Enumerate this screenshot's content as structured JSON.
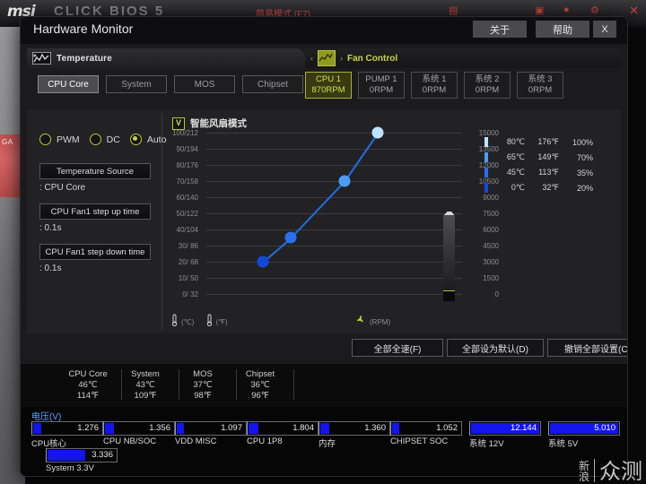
{
  "background": {
    "brand": "msi",
    "brand_sub": "CLICK BIOS 5",
    "mode_label": "简易模式 (F7)",
    "badge": "GA",
    "close": "✕"
  },
  "window": {
    "title": "Hardware Monitor",
    "about_label": "关于",
    "help_label": "帮助",
    "close_label": "X"
  },
  "sections": {
    "temperature": {
      "label": "Temperature",
      "icon": "temperature-graph-icon"
    },
    "fan_control": {
      "label": "Fan Control",
      "icon": "fan-graph-icon",
      "prev": "‹",
      "next": "›"
    }
  },
  "source_tabs": [
    {
      "label": "CPU Core",
      "selected": true
    },
    {
      "label": "System",
      "selected": false
    },
    {
      "label": "MOS",
      "selected": false
    },
    {
      "label": "Chipset",
      "selected": false
    }
  ],
  "fan_tabs": [
    {
      "label": "CPU 1",
      "value": "870RPM",
      "selected": true
    },
    {
      "label": "PUMP 1",
      "value": "0RPM",
      "selected": false
    },
    {
      "label": "系统 1",
      "value": "0RPM",
      "selected": false
    },
    {
      "label": "系统 2",
      "value": "0RPM",
      "selected": false
    },
    {
      "label": "系统 3",
      "value": "0RPM",
      "selected": false
    }
  ],
  "controls": {
    "modes": [
      {
        "label": "PWM",
        "selected": false
      },
      {
        "label": "DC",
        "selected": false
      },
      {
        "label": "Auto",
        "selected": true
      }
    ],
    "temp_source_btn": "Temperature Source",
    "temp_source_val": ": CPU Core",
    "step_up_btn": "CPU Fan1 step up time",
    "step_up_val": ": 0.1s",
    "step_down_btn": "CPU Fan1 step down time",
    "step_down_val": ": 0.1s"
  },
  "chart_panel": {
    "smart_mode_label": "智能风扇模式",
    "smart_mode_checked": "V",
    "unit_c": "(℃)",
    "unit_f": "(℉)",
    "unit_rpm": "(RPM)"
  },
  "chart_data": {
    "type": "line",
    "title": "智能风扇模式",
    "xlabel": "",
    "ylabel": "℃ / ℉",
    "y_left_ticks": [
      "100/212",
      "90/194",
      "80/176",
      "70/158",
      "60/140",
      "50/122",
      "40/104",
      "30/ 86",
      "20/ 68",
      "10/ 50",
      "0/ 32"
    ],
    "y_right_ticks": [
      "15000",
      "13500",
      "12000",
      "10500",
      "9000",
      "7500",
      "6000",
      "4500",
      "3000",
      "1500",
      "0"
    ],
    "y_left_range": [
      0,
      100
    ],
    "y_right_range": [
      0,
      15000
    ],
    "grid": true,
    "points": [
      {
        "temp_c": 22,
        "duty_pct": 20,
        "color": "#1448d8"
      },
      {
        "temp_c": 33,
        "duty_pct": 35,
        "color": "#2b6ef0"
      },
      {
        "temp_c": 54,
        "duty_pct": 70,
        "color": "#4d9bf5"
      },
      {
        "temp_c": 67,
        "duty_pct": 100,
        "color": "#bfe3fb"
      }
    ],
    "line_color": "#1f6ee8",
    "rpm_indicator": 870,
    "legend": [
      {
        "swatch": "#bfe3fb",
        "c": "80℃",
        "f": "176℉",
        "pct": "100%"
      },
      {
        "swatch": "#4d9bf5",
        "c": "65℃",
        "f": "149℉",
        "pct": "70%"
      },
      {
        "swatch": "#2b6ef0",
        "c": "45℃",
        "f": "113℉",
        "pct": "35%"
      },
      {
        "swatch": "#1448d8",
        "c": "0℃",
        "f": "32℉",
        "pct": "20%"
      }
    ]
  },
  "actions": [
    {
      "label": "全部全速(F)"
    },
    {
      "label": "全部设为默认(D)"
    },
    {
      "label": "撤销全部设置(C)"
    }
  ],
  "temp_summary": [
    {
      "name": "CPU Core",
      "c": "46℃",
      "f": "114℉"
    },
    {
      "name": "System",
      "c": "43℃",
      "f": "109℉"
    },
    {
      "name": "MOS",
      "c": "37℃",
      "f": "98℉"
    },
    {
      "name": "Chipset",
      "c": "36℃",
      "f": "96℉"
    }
  ],
  "voltage": {
    "title": "电压(V)",
    "items": [
      {
        "label": "CPU核心",
        "value": "1.276",
        "fill_pct": 12
      },
      {
        "label": "CPU NB/SOC",
        "value": "1.356",
        "fill_pct": 13
      },
      {
        "label": "VDD MISC",
        "value": "1.097",
        "fill_pct": 11
      },
      {
        "label": "CPU 1P8",
        "value": "1.804",
        "fill_pct": 15
      },
      {
        "label": "内存",
        "value": "1.360",
        "fill_pct": 13
      },
      {
        "label": "CHIPSET SOC",
        "value": "1.052",
        "fill_pct": 10
      },
      {
        "label": "系统 12V",
        "value": "12.144",
        "fill_pct": 100
      },
      {
        "label": "系统 5V",
        "value": "5.010",
        "fill_pct": 100
      },
      {
        "label": "System 3.3V",
        "value": "3.336",
        "fill_pct": 55
      }
    ]
  },
  "watermark": {
    "line1": "新",
    "line2": "浪",
    "big": "众测"
  }
}
